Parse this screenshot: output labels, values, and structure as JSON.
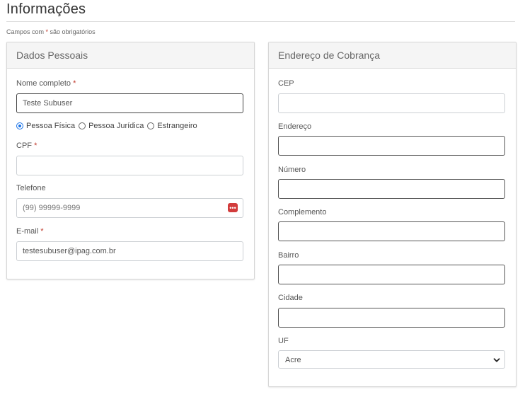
{
  "page": {
    "title": "Informações",
    "required_note_prefix": "Campos com ",
    "required_note_mark": "*",
    "required_note_suffix": " são obrigatórios"
  },
  "personal": {
    "header": "Dados Pessoais",
    "full_name": {
      "label": "Nome completo",
      "required": "*",
      "value": "Teste Subuser"
    },
    "person_type": {
      "options": [
        "Pessoa Física",
        "Pessoa Jurídica",
        "Estrangeiro"
      ],
      "selected": "Pessoa Física"
    },
    "cpf": {
      "label": "CPF",
      "required": "*",
      "value": ""
    },
    "phone": {
      "label": "Telefone",
      "placeholder": "(99) 99999-9999",
      "icon": "password-manager-icon"
    },
    "email": {
      "label": "E-mail",
      "required": "*",
      "value": "testesubuser@ipag.com.br"
    }
  },
  "billing": {
    "header": "Endereço de Cobrança",
    "cep": {
      "label": "CEP",
      "value": ""
    },
    "address": {
      "label": "Endereço",
      "value": ""
    },
    "number": {
      "label": "Número",
      "value": ""
    },
    "complement": {
      "label": "Complemento",
      "value": ""
    },
    "district": {
      "label": "Bairro",
      "value": ""
    },
    "city": {
      "label": "Cidade",
      "value": ""
    },
    "state": {
      "label": "UF",
      "selected": "Acre"
    }
  },
  "colors": {
    "accent": "#1a73e8",
    "required": "#c0392b",
    "icon_red": "#d23c3c"
  }
}
